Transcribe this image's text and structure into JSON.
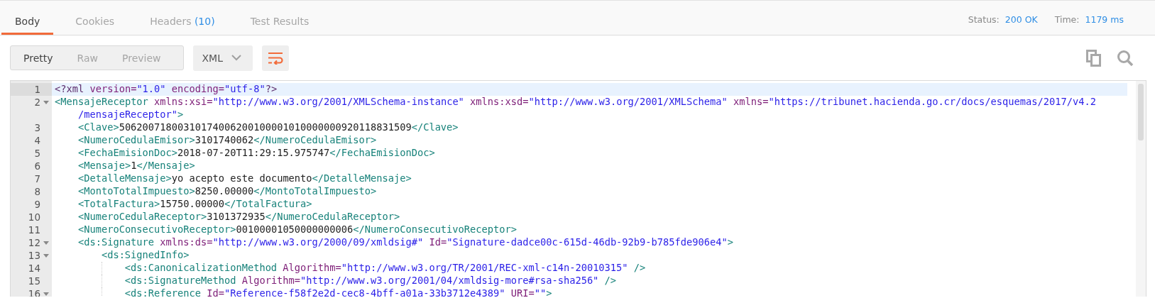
{
  "tabs": [
    {
      "label": "Body",
      "selected": true
    },
    {
      "label": "Cookies",
      "selected": false
    },
    {
      "label": "Headers",
      "count": "(10)",
      "selected": false
    },
    {
      "label": "Test Results",
      "selected": false
    }
  ],
  "status": [
    {
      "label": "Status:",
      "value": "200 OK"
    },
    {
      "label": "Time:",
      "value": "1179 ms"
    }
  ],
  "view_modes": [
    {
      "label": "Pretty",
      "selected": true
    },
    {
      "label": "Raw",
      "selected": false
    },
    {
      "label": "Preview",
      "selected": false
    }
  ],
  "format": "XML",
  "wrap_lines": {
    "on": true
  },
  "editor": {
    "lines": [
      {
        "number": "1",
        "foldable": false,
        "current": true,
        "rows": [
          [
            {
              "kind": "meta",
              "text": "<?xml"
            },
            {
              "kind": "attr",
              "text": " version="
            },
            {
              "kind": "value",
              "text": "\"1.0\""
            },
            {
              "kind": "attr",
              "text": " encoding="
            },
            {
              "kind": "value",
              "text": "\"utf-8\""
            },
            {
              "kind": "meta",
              "text": "?>"
            }
          ]
        ]
      },
      {
        "number": "2",
        "foldable": true,
        "current": false,
        "rows": [
          [
            {
              "kind": "tag",
              "text": "<MensajeReceptor"
            },
            {
              "kind": "attr",
              "text": " xmlns:xsi="
            },
            {
              "kind": "value",
              "text": "\"http://www.w3.org/2001/XMLSchema-instance\""
            },
            {
              "kind": "attr",
              "text": " xmlns:xsd="
            },
            {
              "kind": "value",
              "text": "\"http://www.w3.org/2001/XMLSchema\""
            },
            {
              "kind": "attr",
              "text": " xmlns="
            },
            {
              "kind": "value",
              "text": "\"https://tribunet.hacienda.go.cr/docs/esquemas/2017/v4.2"
            }
          ],
          [
            {
              "kind": "value",
              "text": "/mensajeReceptor\""
            },
            {
              "kind": "tag",
              "text": ">"
            }
          ]
        ],
        "children": [
          {
            "number": "3",
            "foldable": false,
            "current": false,
            "rows": [
              [
                {
                  "kind": "tag",
                  "text": "<Clave>"
                },
                {
                  "kind": "text",
                  "text": "50620071800310174006200100001010000000920118831509"
                },
                {
                  "kind": "tag",
                  "text": "</Clave>"
                }
              ]
            ]
          },
          {
            "number": "4",
            "foldable": false,
            "current": false,
            "rows": [
              [
                {
                  "kind": "tag",
                  "text": "<NumeroCedulaEmisor>"
                },
                {
                  "kind": "text",
                  "text": "3101740062"
                },
                {
                  "kind": "tag",
                  "text": "</NumeroCedulaEmisor>"
                }
              ]
            ]
          },
          {
            "number": "5",
            "foldable": false,
            "current": false,
            "rows": [
              [
                {
                  "kind": "tag",
                  "text": "<FechaEmisionDoc>"
                },
                {
                  "kind": "text",
                  "text": "2018-07-20T11:29:15.975747"
                },
                {
                  "kind": "tag",
                  "text": "</FechaEmisionDoc>"
                }
              ]
            ]
          },
          {
            "number": "6",
            "foldable": false,
            "current": false,
            "rows": [
              [
                {
                  "kind": "tag",
                  "text": "<Mensaje>"
                },
                {
                  "kind": "text",
                  "text": "1"
                },
                {
                  "kind": "tag",
                  "text": "</Mensaje>"
                }
              ]
            ]
          },
          {
            "number": "7",
            "foldable": false,
            "current": false,
            "rows": [
              [
                {
                  "kind": "tag",
                  "text": "<DetalleMensaje>"
                },
                {
                  "kind": "text",
                  "text": "yo acepto este documento"
                },
                {
                  "kind": "tag",
                  "text": "</DetalleMensaje>"
                }
              ]
            ]
          },
          {
            "number": "8",
            "foldable": false,
            "current": false,
            "rows": [
              [
                {
                  "kind": "tag",
                  "text": "<MontoTotalImpuesto>"
                },
                {
                  "kind": "text",
                  "text": "8250.00000"
                },
                {
                  "kind": "tag",
                  "text": "</MontoTotalImpuesto>"
                }
              ]
            ]
          },
          {
            "number": "9",
            "foldable": false,
            "current": false,
            "rows": [
              [
                {
                  "kind": "tag",
                  "text": "<TotalFactura>"
                },
                {
                  "kind": "text",
                  "text": "15750.00000"
                },
                {
                  "kind": "tag",
                  "text": "</TotalFactura>"
                }
              ]
            ]
          },
          {
            "number": "10",
            "foldable": false,
            "current": false,
            "rows": [
              [
                {
                  "kind": "tag",
                  "text": "<NumeroCedulaReceptor>"
                },
                {
                  "kind": "text",
                  "text": "3101372935"
                },
                {
                  "kind": "tag",
                  "text": "</NumeroCedulaReceptor>"
                }
              ]
            ]
          },
          {
            "number": "11",
            "foldable": false,
            "current": false,
            "rows": [
              [
                {
                  "kind": "tag",
                  "text": "<NumeroConsecutivoReceptor>"
                },
                {
                  "kind": "text",
                  "text": "00100001050000000006"
                },
                {
                  "kind": "tag",
                  "text": "</NumeroConsecutivoReceptor>"
                }
              ]
            ]
          },
          {
            "number": "12",
            "foldable": true,
            "current": false,
            "rows": [
              [
                {
                  "kind": "tag",
                  "text": "<ds:Signature"
                },
                {
                  "kind": "attr",
                  "text": " xmlns:ds="
                },
                {
                  "kind": "value",
                  "text": "\"http://www.w3.org/2000/09/xmldsig#\""
                },
                {
                  "kind": "attr",
                  "text": " Id="
                },
                {
                  "kind": "value",
                  "text": "\"Signature-dadce00c-615d-46db-92b9-b785fde906e4\""
                },
                {
                  "kind": "tag",
                  "text": ">"
                }
              ]
            ],
            "children": [
              {
                "number": "13",
                "foldable": true,
                "current": false,
                "rows": [
                  [
                    {
                      "kind": "tag",
                      "text": "<ds:SignedInfo>"
                    }
                  ]
                ],
                "children": [
                  {
                    "number": "14",
                    "foldable": false,
                    "current": false,
                    "rows": [
                      [
                        {
                          "kind": "tag",
                          "text": "<ds:CanonicalizationMethod"
                        },
                        {
                          "kind": "attr",
                          "text": " Algorithm="
                        },
                        {
                          "kind": "value",
                          "text": "\"http://www.w3.org/TR/2001/REC-xml-c14n-20010315\""
                        },
                        {
                          "kind": "tag",
                          "text": " />"
                        }
                      ]
                    ]
                  },
                  {
                    "number": "15",
                    "foldable": false,
                    "current": false,
                    "rows": [
                      [
                        {
                          "kind": "tag",
                          "text": "<ds:SignatureMethod"
                        },
                        {
                          "kind": "attr",
                          "text": " Algorithm="
                        },
                        {
                          "kind": "value",
                          "text": "\"http://www.w3.org/2001/04/xmldsig-more#rsa-sha256\""
                        },
                        {
                          "kind": "tag",
                          "text": " />"
                        }
                      ]
                    ]
                  },
                  {
                    "number": "16",
                    "foldable": true,
                    "current": false,
                    "rows": [
                      [
                        {
                          "kind": "tag",
                          "text": "<ds:Reference"
                        },
                        {
                          "kind": "attr",
                          "text": " Id="
                        },
                        {
                          "kind": "value",
                          "text": "\"Reference-f58f2e2d-cec8-4bff-a01a-33b3712e4389\""
                        },
                        {
                          "kind": "attr",
                          "text": " URI="
                        },
                        {
                          "kind": "value",
                          "text": "\"\""
                        },
                        {
                          "kind": "tag",
                          "text": ">"
                        }
                      ]
                    ]
                  }
                ]
              }
            ]
          }
        ]
      }
    ]
  }
}
